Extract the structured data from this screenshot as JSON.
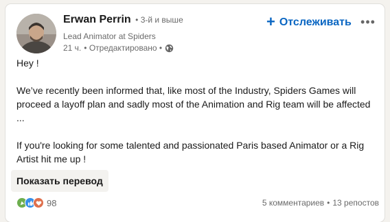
{
  "author": {
    "name": "Erwan Perrin",
    "degree": "• 3-й и выше",
    "headline": "Lead Animator at Spiders",
    "time": "21 ч.",
    "edited": "• Отредактировано •"
  },
  "actions": {
    "follow_label": "Отслеживать",
    "more_label": "•••"
  },
  "post": {
    "paragraphs": [
      "Hey !",
      "We’ve recently been informed that, like most of the Industry, Spiders Games will proceed a layoff plan and sadly most of the Animation and Rig team will be affected ...",
      "If you're looking for some talented and passionated Paris based Animator or a Rig Artist hit me up !"
    ]
  },
  "translate_label": "Показать перевод",
  "social": {
    "reaction_count": "98",
    "comments": "5 комментариев",
    "separator": "•",
    "reposts": "13 репостов"
  },
  "colors": {
    "accent": "#0a66c2",
    "like": "#378fe9",
    "love": "#df704d",
    "celebrate": "#6dae4f"
  },
  "icons": [
    "avatar",
    "globe-icon",
    "plus-icon",
    "more-icon",
    "like-reaction-icon",
    "celebrate-reaction-icon",
    "love-reaction-icon"
  ]
}
